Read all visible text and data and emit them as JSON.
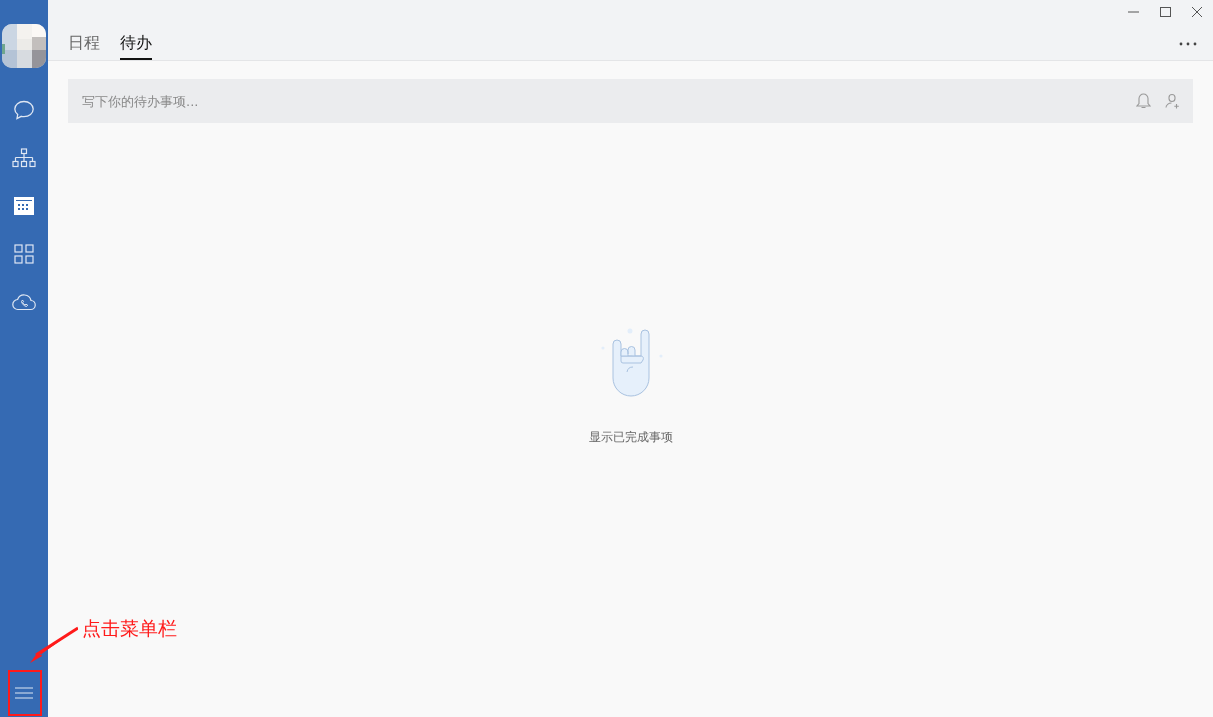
{
  "sidebar": {
    "items": [
      {
        "kind": "chat",
        "selected": false
      },
      {
        "kind": "org",
        "selected": false
      },
      {
        "kind": "calendar",
        "selected": true
      },
      {
        "kind": "apps",
        "selected": false
      },
      {
        "kind": "cloud",
        "selected": false
      }
    ]
  },
  "tabs": [
    {
      "label": "日程",
      "selected": false
    },
    {
      "label": "待办",
      "selected": true
    }
  ],
  "todo_input": {
    "placeholder": "写下你的待办事项..."
  },
  "empty_state": {
    "text": "显示已完成事项"
  },
  "annotation": {
    "text": "点击菜单栏"
  }
}
